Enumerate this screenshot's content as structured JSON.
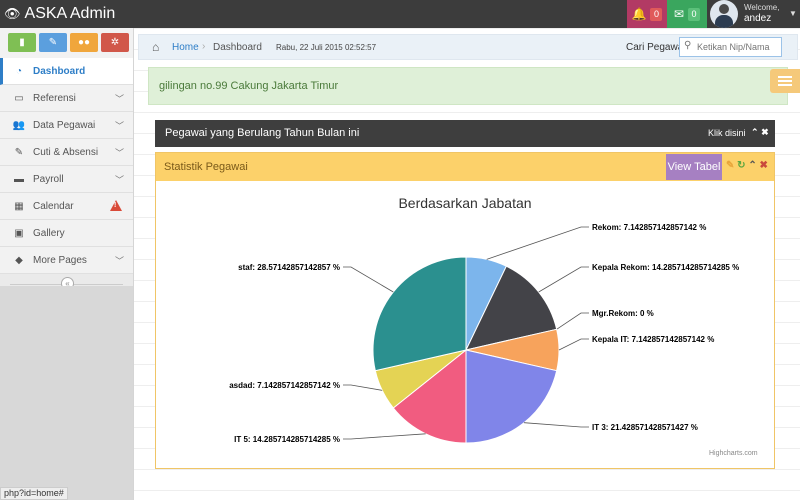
{
  "app": {
    "title": "ASKA Admin"
  },
  "header": {
    "notifications_count": "0",
    "messages_count": "0",
    "user": {
      "welcome": "Welcome,",
      "name": "andez"
    }
  },
  "sidebar": {
    "items": [
      {
        "label": "Dashboard",
        "icon": "dashboard-icon"
      },
      {
        "label": "Referensi",
        "icon": "monitor-icon"
      },
      {
        "label": "Data Pegawai",
        "icon": "users-icon"
      },
      {
        "label": "Cuti & Absensi",
        "icon": "edit-icon"
      },
      {
        "label": "Payroll",
        "icon": "card-icon"
      },
      {
        "label": "Calendar",
        "icon": "calendar-icon"
      },
      {
        "label": "Gallery",
        "icon": "picture-icon"
      },
      {
        "label": "More Pages",
        "icon": "tag-icon"
      }
    ]
  },
  "breadcrumb": {
    "home": "Home",
    "current": "Dashboard"
  },
  "datetime": "Rabu, 22 Juli 2015 02:52:57",
  "search": {
    "label": "Cari Pegawai",
    "placeholder": "Ketikan Nip/Nama"
  },
  "alert": {
    "text": "gilingan no.99 Cakung Jakarta Timur"
  },
  "birthday_panel": {
    "title": "Pegawai yang Berulang Tahun Bulan ini",
    "link": "Klik disini"
  },
  "stats_panel": {
    "title": "Statistik Pegawai",
    "view_button": "View Tabel",
    "credits": "Highcharts.com"
  },
  "status_url": "php?id=home#",
  "chart_data": {
    "type": "pie",
    "title": "Berdasarkan Jabatan",
    "slices": [
      {
        "name": "Rekom",
        "value": 7.142857142857142,
        "label": "Rekom: 7.142857142857142 %",
        "color": "#7cb5ec"
      },
      {
        "name": "Kepala Rekom",
        "value": 14.285714285714285,
        "label": "Kepala Rekom: 14.285714285714285 %",
        "color": "#434348"
      },
      {
        "name": "Mgr.Rekom",
        "value": 0,
        "label": "Mgr.Rekom: 0 %",
        "color": "#90ed7d"
      },
      {
        "name": "Kepala IT",
        "value": 7.142857142857142,
        "label": "Kepala IT: 7.142857142857142 %",
        "color": "#f7a35c"
      },
      {
        "name": "IT 3",
        "value": 21.428571428571427,
        "label": "IT 3: 21.428571428571427 %",
        "color": "#8085e9"
      },
      {
        "name": "IT 5",
        "value": 14.285714285714285,
        "label": "IT 5: 14.285714285714285 %",
        "color": "#f15c80"
      },
      {
        "name": "asdad",
        "value": 7.142857142857142,
        "label": "asdad: 7.142857142857142 %",
        "color": "#e4d354"
      },
      {
        "name": "staf",
        "value": 28.57142857142857,
        "label": "staf: 28.57142857142857 %",
        "color": "#2b908f"
      }
    ]
  }
}
